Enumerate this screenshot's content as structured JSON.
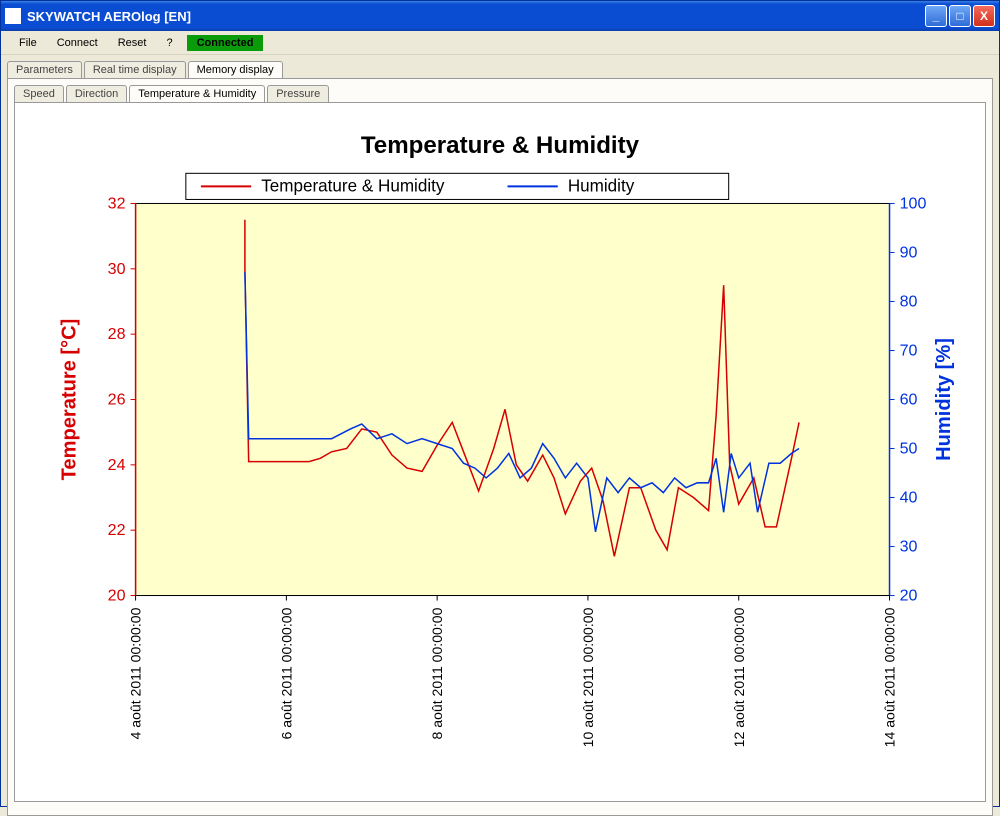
{
  "window": {
    "title": "SKYWATCH AEROlog [EN]"
  },
  "menu": {
    "file": "File",
    "connect": "Connect",
    "reset": "Reset",
    "help": "?",
    "status": "Connected"
  },
  "tabs_main": [
    {
      "label": "Parameters",
      "active": false
    },
    {
      "label": "Real time display",
      "active": false
    },
    {
      "label": "Memory display",
      "active": true
    }
  ],
  "tabs_sub": [
    {
      "label": "Speed",
      "active": false
    },
    {
      "label": "Direction",
      "active": false
    },
    {
      "label": "Temperature & Humidity",
      "active": true
    },
    {
      "label": "Pressure",
      "active": false
    }
  ],
  "chart_data": {
    "type": "line",
    "title": "Temperature & Humidity",
    "legend": [
      "Temperature & Humidity",
      "Humidity"
    ],
    "x_ticks": [
      "4 août 2011 00:00:00",
      "6 août 2011 00:00:00",
      "8 août 2011 00:00:00",
      "10 août 2011 00:00:00",
      "12 août 2011 00:00:00",
      "14 août 2011 00:00:00"
    ],
    "y_left": {
      "label": "Temperature [°C]",
      "min": 20,
      "max": 32,
      "step": 2,
      "color": "#d60000"
    },
    "y_right": {
      "label": "Humidity [%]",
      "min": 20,
      "max": 100,
      "step": 10,
      "color": "#0033dd"
    },
    "series": [
      {
        "name": "Temperature & Humidity",
        "axis": "left",
        "color": "#d60000",
        "points": [
          {
            "x": 5.45,
            "y": 31.5
          },
          {
            "x": 5.45,
            "y": 30.0
          },
          {
            "x": 5.5,
            "y": 24.1
          },
          {
            "x": 6.0,
            "y": 24.1
          },
          {
            "x": 6.3,
            "y": 24.1
          },
          {
            "x": 6.45,
            "y": 24.2
          },
          {
            "x": 6.6,
            "y": 24.4
          },
          {
            "x": 6.8,
            "y": 24.5
          },
          {
            "x": 7.0,
            "y": 25.1
          },
          {
            "x": 7.2,
            "y": 25.0
          },
          {
            "x": 7.4,
            "y": 24.3
          },
          {
            "x": 7.6,
            "y": 23.9
          },
          {
            "x": 7.8,
            "y": 23.8
          },
          {
            "x": 8.0,
            "y": 24.6
          },
          {
            "x": 8.2,
            "y": 25.3
          },
          {
            "x": 8.4,
            "y": 24.1
          },
          {
            "x": 8.55,
            "y": 23.2
          },
          {
            "x": 8.75,
            "y": 24.5
          },
          {
            "x": 8.9,
            "y": 25.7
          },
          {
            "x": 9.05,
            "y": 24.0
          },
          {
            "x": 9.2,
            "y": 23.5
          },
          {
            "x": 9.4,
            "y": 24.3
          },
          {
            "x": 9.55,
            "y": 23.6
          },
          {
            "x": 9.7,
            "y": 22.5
          },
          {
            "x": 9.9,
            "y": 23.5
          },
          {
            "x": 10.05,
            "y": 23.9
          },
          {
            "x": 10.2,
            "y": 22.9
          },
          {
            "x": 10.35,
            "y": 21.2
          },
          {
            "x": 10.55,
            "y": 23.3
          },
          {
            "x": 10.7,
            "y": 23.3
          },
          {
            "x": 10.9,
            "y": 22.0
          },
          {
            "x": 11.05,
            "y": 21.4
          },
          {
            "x": 11.2,
            "y": 23.3
          },
          {
            "x": 11.4,
            "y": 23.0
          },
          {
            "x": 11.6,
            "y": 22.6
          },
          {
            "x": 11.7,
            "y": 25.5
          },
          {
            "x": 11.8,
            "y": 29.5
          },
          {
            "x": 11.88,
            "y": 24.0
          },
          {
            "x": 12.0,
            "y": 22.8
          },
          {
            "x": 12.2,
            "y": 23.6
          },
          {
            "x": 12.35,
            "y": 22.1
          },
          {
            "x": 12.5,
            "y": 22.1
          },
          {
            "x": 12.7,
            "y": 24.2
          },
          {
            "x": 12.8,
            "y": 25.3
          }
        ]
      },
      {
        "name": "Humidity",
        "axis": "right",
        "color": "#0033dd",
        "points": [
          {
            "x": 5.45,
            "y": 86
          },
          {
            "x": 5.5,
            "y": 52
          },
          {
            "x": 5.8,
            "y": 52
          },
          {
            "x": 6.2,
            "y": 52
          },
          {
            "x": 6.6,
            "y": 52
          },
          {
            "x": 6.85,
            "y": 54
          },
          {
            "x": 7.0,
            "y": 55
          },
          {
            "x": 7.2,
            "y": 52
          },
          {
            "x": 7.4,
            "y": 53
          },
          {
            "x": 7.6,
            "y": 51
          },
          {
            "x": 7.8,
            "y": 52
          },
          {
            "x": 8.0,
            "y": 51
          },
          {
            "x": 8.2,
            "y": 50
          },
          {
            "x": 8.35,
            "y": 47
          },
          {
            "x": 8.5,
            "y": 46
          },
          {
            "x": 8.65,
            "y": 44
          },
          {
            "x": 8.8,
            "y": 46
          },
          {
            "x": 8.95,
            "y": 49
          },
          {
            "x": 9.1,
            "y": 44
          },
          {
            "x": 9.25,
            "y": 46
          },
          {
            "x": 9.4,
            "y": 51
          },
          {
            "x": 9.55,
            "y": 48
          },
          {
            "x": 9.7,
            "y": 44
          },
          {
            "x": 9.85,
            "y": 47
          },
          {
            "x": 10.0,
            "y": 44
          },
          {
            "x": 10.1,
            "y": 33
          },
          {
            "x": 10.25,
            "y": 44
          },
          {
            "x": 10.4,
            "y": 41
          },
          {
            "x": 10.55,
            "y": 44
          },
          {
            "x": 10.7,
            "y": 42
          },
          {
            "x": 10.85,
            "y": 43
          },
          {
            "x": 11.0,
            "y": 41
          },
          {
            "x": 11.15,
            "y": 44
          },
          {
            "x": 11.3,
            "y": 42
          },
          {
            "x": 11.45,
            "y": 43
          },
          {
            "x": 11.6,
            "y": 43
          },
          {
            "x": 11.7,
            "y": 48
          },
          {
            "x": 11.8,
            "y": 37
          },
          {
            "x": 11.9,
            "y": 49
          },
          {
            "x": 12.0,
            "y": 44
          },
          {
            "x": 12.15,
            "y": 47
          },
          {
            "x": 12.25,
            "y": 37
          },
          {
            "x": 12.4,
            "y": 47
          },
          {
            "x": 12.55,
            "y": 47
          },
          {
            "x": 12.7,
            "y": 49
          },
          {
            "x": 12.8,
            "y": 50
          }
        ]
      }
    ]
  }
}
